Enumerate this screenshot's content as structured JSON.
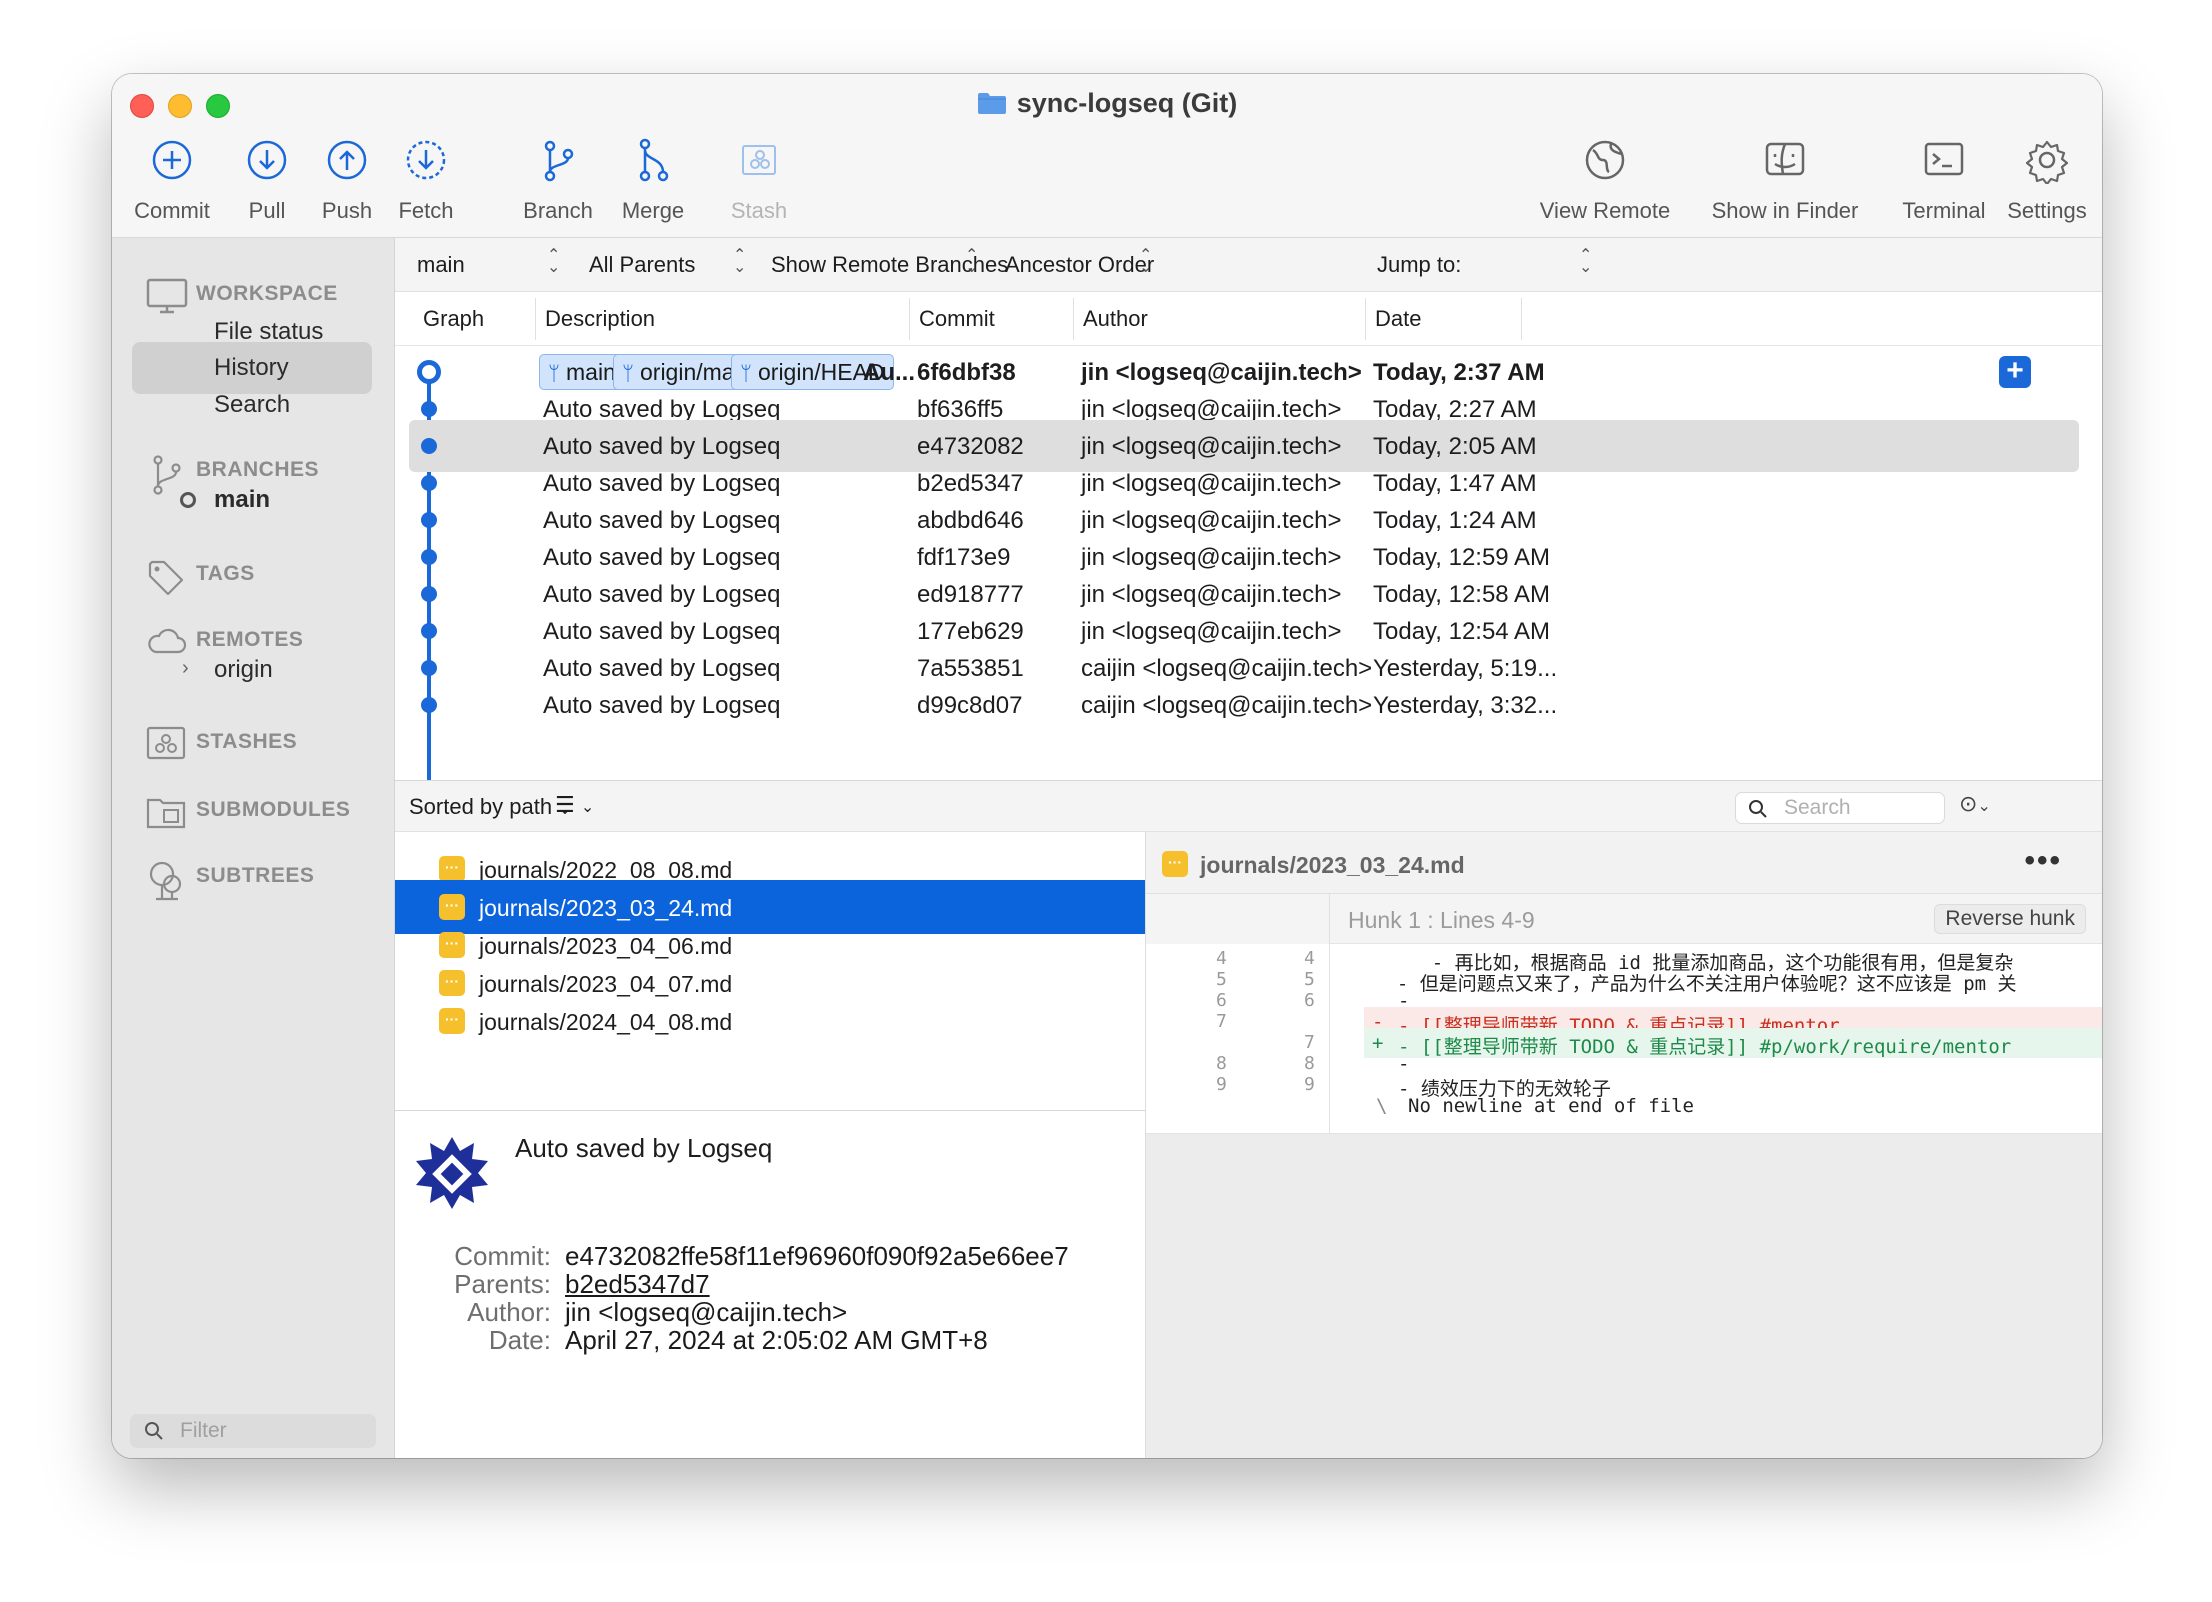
{
  "window": {
    "title": "sync-logseq (Git)"
  },
  "toolbar": {
    "commit": "Commit",
    "pull": "Pull",
    "push": "Push",
    "fetch": "Fetch",
    "branch": "Branch",
    "merge": "Merge",
    "stash": "Stash",
    "view_remote": "View Remote",
    "show_in_finder": "Show in Finder",
    "terminal": "Terminal",
    "settings": "Settings"
  },
  "sidebar": {
    "workspace": "WORKSPACE",
    "file_status": "File status",
    "history": "History",
    "search": "Search",
    "branches": "BRANCHES",
    "branch_main": "main",
    "tags": "TAGS",
    "remotes": "REMOTES",
    "remote_origin": "origin",
    "stashes": "STASHES",
    "submodules": "SUBMODULES",
    "subtrees": "SUBTREES",
    "filter_placeholder": "Filter"
  },
  "filterbar": {
    "branch": "main",
    "parents": "All Parents",
    "remote": "Show Remote Branches",
    "order": "Ancestor Order",
    "jump": "Jump to:"
  },
  "columns": {
    "graph": "Graph",
    "description": "Description",
    "commit": "Commit",
    "author": "Author",
    "date": "Date"
  },
  "head_tags": [
    "main",
    "origin/main",
    "origin/HEAD"
  ],
  "commits": [
    {
      "desc": "Au...",
      "hash": "6f6dbf38",
      "author": "jin <logseq@caijin.tech>",
      "date": "Today, 2:37 AM"
    },
    {
      "desc": "Auto saved by Logseq",
      "hash": "bf636ff5",
      "author": "jin <logseq@caijin.tech>",
      "date": "Today, 2:27 AM"
    },
    {
      "desc": "Auto saved by Logseq",
      "hash": "e4732082",
      "author": "jin <logseq@caijin.tech>",
      "date": "Today, 2:05 AM"
    },
    {
      "desc": "Auto saved by Logseq",
      "hash": "b2ed5347",
      "author": "jin <logseq@caijin.tech>",
      "date": "Today, 1:47 AM"
    },
    {
      "desc": "Auto saved by Logseq",
      "hash": "abdbd646",
      "author": "jin <logseq@caijin.tech>",
      "date": "Today, 1:24 AM"
    },
    {
      "desc": "Auto saved by Logseq",
      "hash": "fdf173e9",
      "author": "jin <logseq@caijin.tech>",
      "date": "Today, 12:59 AM"
    },
    {
      "desc": "Auto saved by Logseq",
      "hash": "ed918777",
      "author": "jin <logseq@caijin.tech>",
      "date": "Today, 12:58 AM"
    },
    {
      "desc": "Auto saved by Logseq",
      "hash": "177eb629",
      "author": "jin <logseq@caijin.tech>",
      "date": "Today, 12:54 AM"
    },
    {
      "desc": "Auto saved by Logseq",
      "hash": "7a553851",
      "author": "caijin <logseq@caijin.tech>",
      "date": "Yesterday, 5:19..."
    },
    {
      "desc": "Auto saved by Logseq",
      "hash": "d99c8d07",
      "author": "caijin <logseq@caijin.tech>",
      "date": "Yesterday, 3:32..."
    }
  ],
  "sortbar": {
    "sort": "Sorted by path",
    "search_placeholder": "Search"
  },
  "files": [
    "journals/2022_08_08.md",
    "journals/2023_03_24.md",
    "journals/2023_04_06.md",
    "journals/2023_04_07.md",
    "journals/2024_04_08.md"
  ],
  "details": {
    "message": "Auto saved by Logseq",
    "commit_label": "Commit:",
    "commit_value": "e4732082ffe58f11ef96960f090f92a5e66ee7",
    "parents_label": "Parents:",
    "parents_value": "b2ed5347d7",
    "author_label": "Author:",
    "author_value": "jin <logseq@caijin.tech>",
    "date_label": "Date:",
    "date_value": "April 27, 2024 at 2:05:02 AM GMT+8"
  },
  "diff": {
    "file": "journals/2023_03_24.md",
    "more": "•••",
    "hunk": "Hunk 1 : Lines 4-9",
    "reverse": "Reverse hunk",
    "lines": [
      {
        "a": "4",
        "b": "4",
        "text": "    - 再比如，根据商品 id 批量添加商品，这个功能很有用，但是复杂"
      },
      {
        "a": "5",
        "b": "5",
        "text": "  - 但是问题点又来了，产品为什么不关注用户体验呢？这不应该是 pm 关"
      },
      {
        "a": "6",
        "b": "6",
        "text": "-"
      },
      {
        "a": "7",
        "b": "",
        "text": "- [[整理导师带新 TODO & 重点记录]] #mentor",
        "prefix": "-"
      },
      {
        "a": "",
        "b": "7",
        "text": "- [[整理导师带新 TODO & 重点记录]] #p/work/require/mentor",
        "prefix": "+"
      },
      {
        "a": "8",
        "b": "8",
        "text": "-"
      },
      {
        "a": "9",
        "b": "9",
        "text": "- 绩效压力下的无效轮子"
      },
      {
        "a": "",
        "b": "",
        "text": "No newline at end of file",
        "prefix": "\\"
      }
    ]
  }
}
